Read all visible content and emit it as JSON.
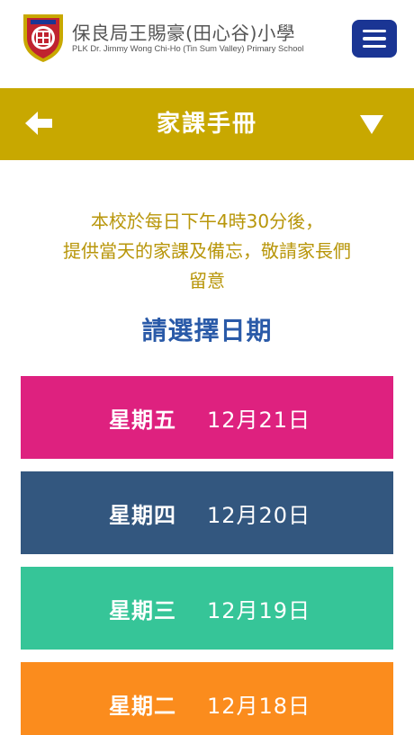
{
  "header": {
    "school_name_zh": "保良局王賜豪(田心谷)小學",
    "school_name_en": "PLK Dr. Jimmy Wong Chi-Ho (Tin Sum Valley) Primary School",
    "menu_icon": "hamburger-menu-icon"
  },
  "titlebar": {
    "title": "家課手冊",
    "back_icon": "arrow-left-icon",
    "dropdown_icon": "triangle-down-icon",
    "color": "#c8a800"
  },
  "notice": {
    "line1": "本校於每日下午4時30分後，",
    "line2": "提供當天的家課及備忘，敬請家長們",
    "line3": "留意"
  },
  "choose_date_label": "請選擇日期",
  "days": [
    {
      "weekday": "星期五",
      "date": "12月21日",
      "color": "#de217f"
    },
    {
      "weekday": "星期四",
      "date": "12月20日",
      "color": "#33577f"
    },
    {
      "weekday": "星期三",
      "date": "12月19日",
      "color": "#36c598"
    },
    {
      "weekday": "星期二",
      "date": "12月18日",
      "color": "#fb8c1d"
    }
  ]
}
